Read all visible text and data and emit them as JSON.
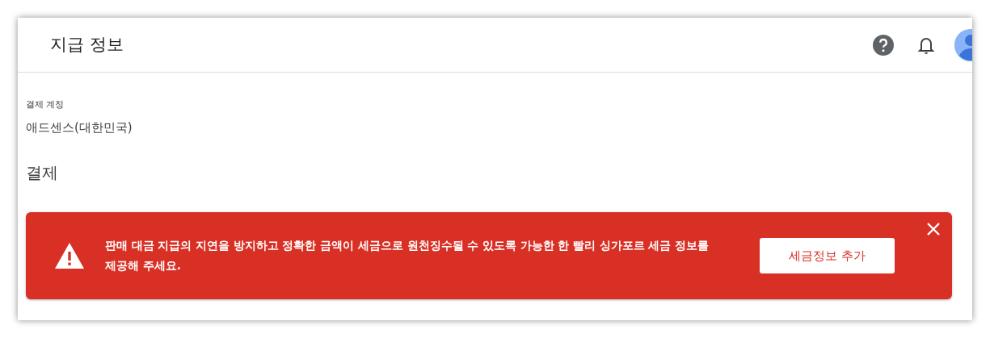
{
  "header": {
    "title": "지급 정보"
  },
  "account": {
    "label": "결제 계정",
    "value": "애드센스(대한민국)"
  },
  "section": {
    "title": "결제"
  },
  "alert": {
    "message": "판매 대금 지급의 지연을 방지하고 정확한 금액이 세금으로 원천징수될 수 있도록 가능한 한 빨리 싱가포르 세금 정보를 제공해 주세요.",
    "button": "세금정보 추가",
    "dismissible": true
  }
}
